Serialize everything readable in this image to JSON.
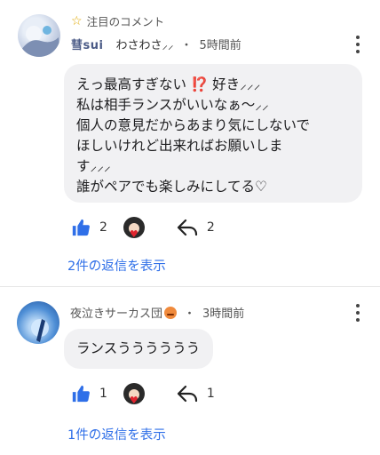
{
  "comments": [
    {
      "pinned_label": "注目のコメント",
      "author": "彗sui",
      "author_suffix": "わさわさ⸝⸝",
      "dot": "・",
      "time": "5時間前",
      "lines": [
        "えっ最高すぎない ",
        "⁉️",
        " 好き⸝⸝⸝",
        "私は相手ランスがいいなぁ〜⸝⸝",
        "個人の意見だからあまり気にしないで",
        "ほしいけれど出来ればお願いしま",
        "す⸝⸝⸝",
        "誰がペアでも楽しみにしてる♡"
      ],
      "likes": "2",
      "replies": "2",
      "view_replies": "2件の返信を表示"
    },
    {
      "author": "夜泣きサーカス団",
      "dot": "・",
      "time": "3時間前",
      "text": "ランスうううううう",
      "likes": "1",
      "replies": "1",
      "view_replies": "1件の返信を表示"
    }
  ],
  "icons": {
    "pinned": "star-outline-icon",
    "like": "thumbs-up-icon",
    "reply": "reply-arrow-icon",
    "more": "more-vertical-icon",
    "reacted": "heart-icon"
  },
  "colors": {
    "accent": "#2f6fe8",
    "star": "#e0a800",
    "bubble": "#f1f1f3",
    "heart": "#e0242e"
  }
}
